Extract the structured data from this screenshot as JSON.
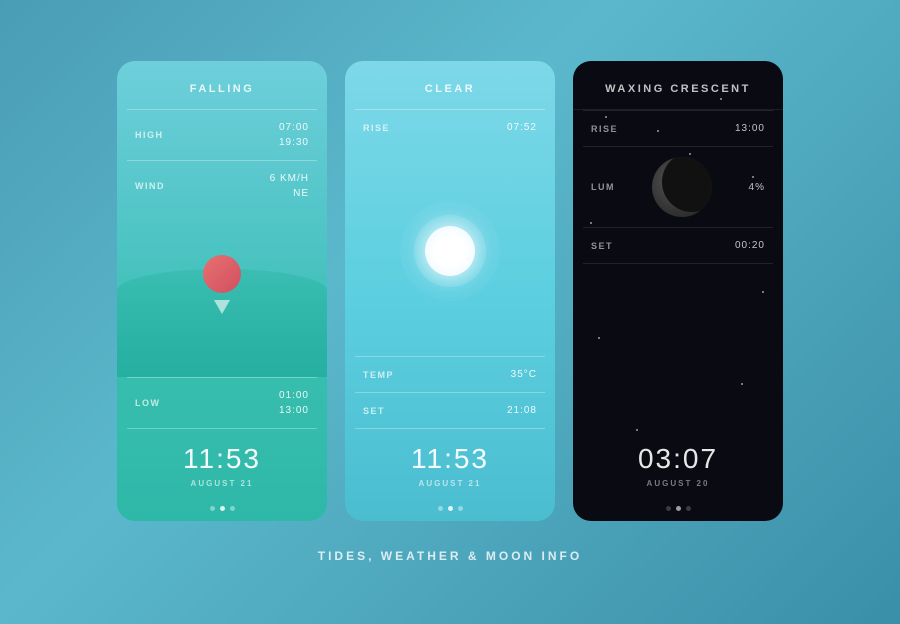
{
  "page": {
    "title": "TIDES, WEATHER & MOON INFO",
    "background_color": "#4a9db5"
  },
  "tides_card": {
    "header": "FALLING",
    "high_label": "HIGH",
    "high_time1": "07:00",
    "high_time2": "19:30",
    "wind_label": "WIND",
    "wind_speed": "6 KM/H",
    "wind_dir": "NE",
    "low_label": "LOW",
    "low_time1": "01:00",
    "low_time2": "13:00",
    "time": "11:53",
    "date": "AUGUST 21",
    "dots": [
      false,
      true,
      false
    ]
  },
  "weather_card": {
    "header": "CLEAR",
    "rise_label": "RISE",
    "rise_time": "07:52",
    "temp_label": "TEMP",
    "temp_value": "35°C",
    "set_label": "SET",
    "set_time": "21:08",
    "time": "11:53",
    "date": "AUGUST 21",
    "dots": [
      false,
      true,
      false
    ]
  },
  "moon_card": {
    "header": "WAXING CRESCENT",
    "rise_label": "RISE",
    "rise_time": "13:00",
    "lum_label": "LUM",
    "lum_value": "4%",
    "set_label": "SET",
    "set_time": "00:20",
    "time": "03:07",
    "date": "AUGUST 20",
    "dots": [
      false,
      true,
      false
    ]
  }
}
